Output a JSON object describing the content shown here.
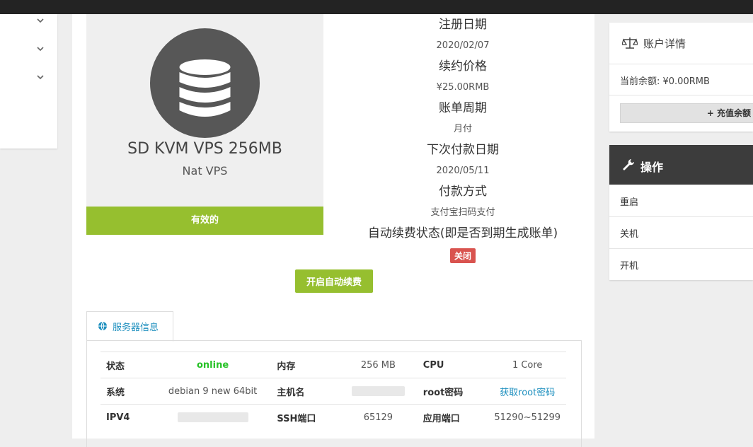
{
  "product": {
    "name": "SD KVM VPS 256MB",
    "group": "Nat VPS",
    "status": "有效的"
  },
  "details": [
    {
      "label": "注册日期",
      "value": "2020/02/07"
    },
    {
      "label": "续约价格",
      "value": "¥25.00RMB"
    },
    {
      "label": "账单周期",
      "value": "月付"
    },
    {
      "label": "下次付款日期",
      "value": "2020/05/11"
    },
    {
      "label": "付款方式",
      "value": "支付宝扫码支付"
    },
    {
      "label": "自动续费状态(即是否到期生成账单)",
      "value": "关闭"
    }
  ],
  "auto_renew_button": "开启自动续费",
  "tab": {
    "label": "服务器信息"
  },
  "server": {
    "status_label": "状态",
    "status_value": "online",
    "memory_label": "内存",
    "memory_value": "256 MB",
    "cpu_label": "CPU",
    "cpu_value": "1 Core",
    "os_label": "系统",
    "os_value": "debian 9 new 64bit",
    "hostname_label": "主机名",
    "rootpw_label": "root密码",
    "rootpw_value": "获取root密码",
    "ipv4_label": "IPV4",
    "ssh_label": "SSH端口",
    "ssh_value": "65129",
    "appport_label": "应用端口",
    "appport_value": "51290~51299"
  },
  "account": {
    "title": "账户详情",
    "balance": "当前余额: ¥0.00RMB",
    "recharge_button": "充值余额"
  },
  "operations": {
    "title": "操作",
    "items": [
      "重启",
      "关机",
      "开机"
    ]
  },
  "colors": {
    "accent_green": "#96bf2f",
    "danger": "#d9534f",
    "link": "#1f90bf",
    "online": "#28c228"
  }
}
